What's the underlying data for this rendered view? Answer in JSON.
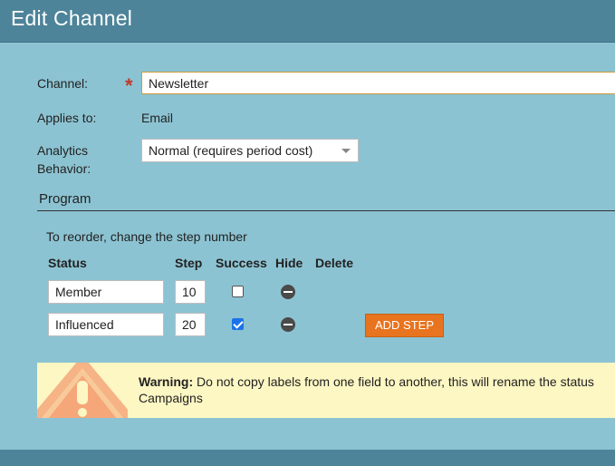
{
  "dialog": {
    "title": "Edit Channel"
  },
  "form": {
    "channel_label": "Channel:",
    "required_mark": "*",
    "channel_value": "Newsletter",
    "applies_label": "Applies to:",
    "applies_value": "Email",
    "analytics_label_line1": "Analytics",
    "analytics_label_line2": "Behavior:",
    "analytics_value": "Normal (requires period cost)"
  },
  "program": {
    "section_title": "Program",
    "hint": "To reorder, change the step number",
    "columns": [
      "Status",
      "Step",
      "Success",
      "Hide",
      "Delete"
    ],
    "rows": [
      {
        "status": "Member",
        "step": "10",
        "success": false
      },
      {
        "status": "Influenced",
        "step": "20",
        "success": true
      }
    ],
    "add_step_label": "ADD STEP"
  },
  "warning": {
    "label": "Warning:",
    "text_line1": " Do not copy labels from one field to another, this will rename the status",
    "text_line2": "Campaigns"
  },
  "colors": {
    "title_bar": "#4d8499",
    "background": "#8cc3d2",
    "accent_button": "#e8741f",
    "warning_bg": "#fdf7c3",
    "required": "#c0392b"
  }
}
